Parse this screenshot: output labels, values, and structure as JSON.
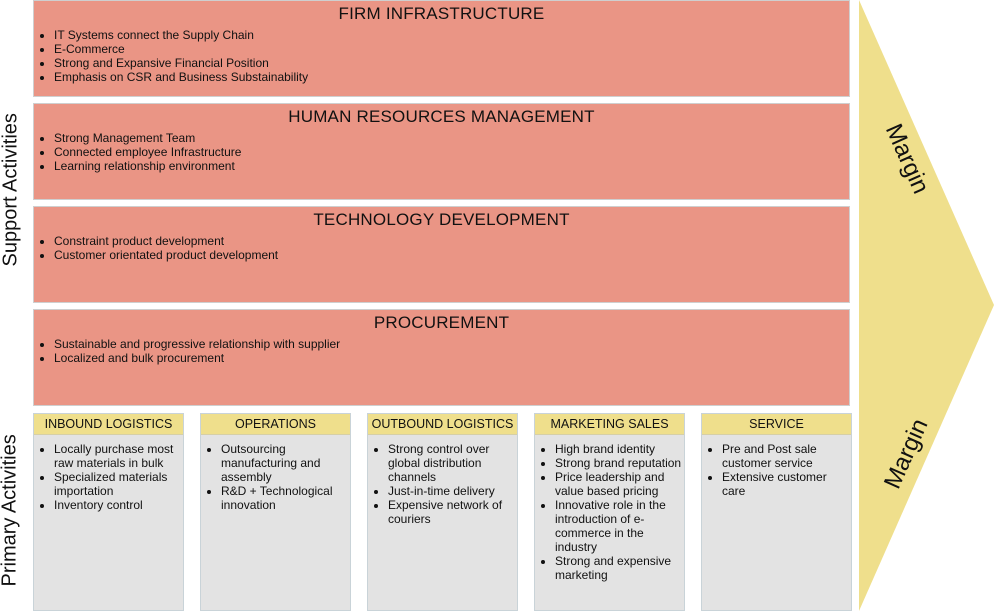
{
  "labels": {
    "support": "Support Activities",
    "primary": "Primary Activities",
    "margin_top": "Margin",
    "margin_bottom": "Margin"
  },
  "colors": {
    "support": "#ea9585",
    "primary_header": "#efdf8c",
    "primary_body": "#e3e3e3",
    "margin": "#efdf8c"
  },
  "support": [
    {
      "title": "FIRM INFRASTRUCTURE",
      "items": [
        "IT Systems connect the Supply Chain",
        "E-Commerce",
        "Strong and Expansive Financial Position",
        "Emphasis on CSR and Business Substainability"
      ]
    },
    {
      "title": "HUMAN RESOURCES MANAGEMENT",
      "items": [
        "Strong Management Team",
        "Connected employee Infrastructure",
        "Learning relationship environment"
      ]
    },
    {
      "title": "TECHNOLOGY DEVELOPMENT",
      "items": [
        "Constraint product development",
        "Customer orientated product development"
      ]
    },
    {
      "title": "PROCUREMENT",
      "items": [
        "Sustainable and progressive relationship with supplier",
        "Localized and bulk procurement"
      ]
    }
  ],
  "primary": [
    {
      "title": "INBOUND LOGISTICS",
      "items": [
        "Locally purchase most raw materials in bulk",
        "Specialized materials importation",
        "Inventory control"
      ]
    },
    {
      "title": "OPERATIONS",
      "items": [
        "Outsourcing manufacturing and assembly",
        "R&D + Technological innovation"
      ]
    },
    {
      "title": "OUTBOUND LOGISTICS",
      "items": [
        "Strong control over global distribution channels",
        "Just-in-time delivery",
        "Expensive network of couriers"
      ]
    },
    {
      "title": "MARKETING SALES",
      "items": [
        "High brand identity",
        "Strong brand reputation",
        "Price leadership and value based pricing",
        "Innovative role in the introduction of e-commerce in the industry",
        "Strong and expensive marketing"
      ]
    },
    {
      "title": "SERVICE",
      "items": [
        "Pre and Post sale customer service",
        "Extensive customer care"
      ]
    }
  ]
}
